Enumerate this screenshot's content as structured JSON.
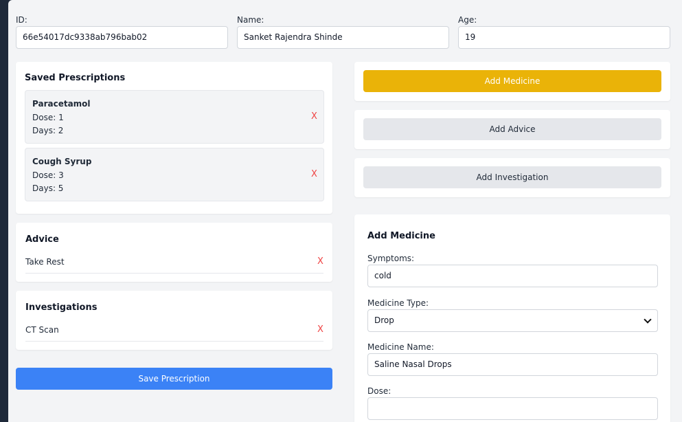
{
  "patient": {
    "id_label": "ID:",
    "id_value": "66e54017dc9338ab796bab02",
    "name_label": "Name:",
    "name_value": "Sanket Rajendra Shinde",
    "age_label": "Age:",
    "age_value": "19"
  },
  "saved_prescriptions": {
    "title": "Saved Prescriptions",
    "items": [
      {
        "name": "Paracetamol",
        "dose": "Dose: 1",
        "days": "Days: 2",
        "remove": "X"
      },
      {
        "name": "Cough Syrup",
        "dose": "Dose: 3",
        "days": "Days: 5",
        "remove": "X"
      }
    ]
  },
  "advice": {
    "title": "Advice",
    "items": [
      {
        "text": "Take Rest",
        "remove": "X"
      }
    ]
  },
  "investigations": {
    "title": "Investigations",
    "items": [
      {
        "text": "CT Scan",
        "remove": "X"
      }
    ]
  },
  "actions": {
    "save_prescription": "Save Prescription",
    "add_medicine": "Add Medicine",
    "add_advice": "Add Advice",
    "add_investigation": "Add Investigation"
  },
  "add_medicine_form": {
    "title": "Add Medicine",
    "symptoms_label": "Symptoms:",
    "symptoms_value": "cold",
    "medicine_type_label": "Medicine Type:",
    "medicine_type_value": "Drop",
    "medicine_name_label": "Medicine Name:",
    "medicine_name_value": "Saline Nasal Drops",
    "dose_label": "Dose:",
    "dose_value": ""
  },
  "colors": {
    "accent_yellow": "#eab308",
    "primary_blue": "#3b82f6",
    "remove_red": "#ef4444"
  }
}
